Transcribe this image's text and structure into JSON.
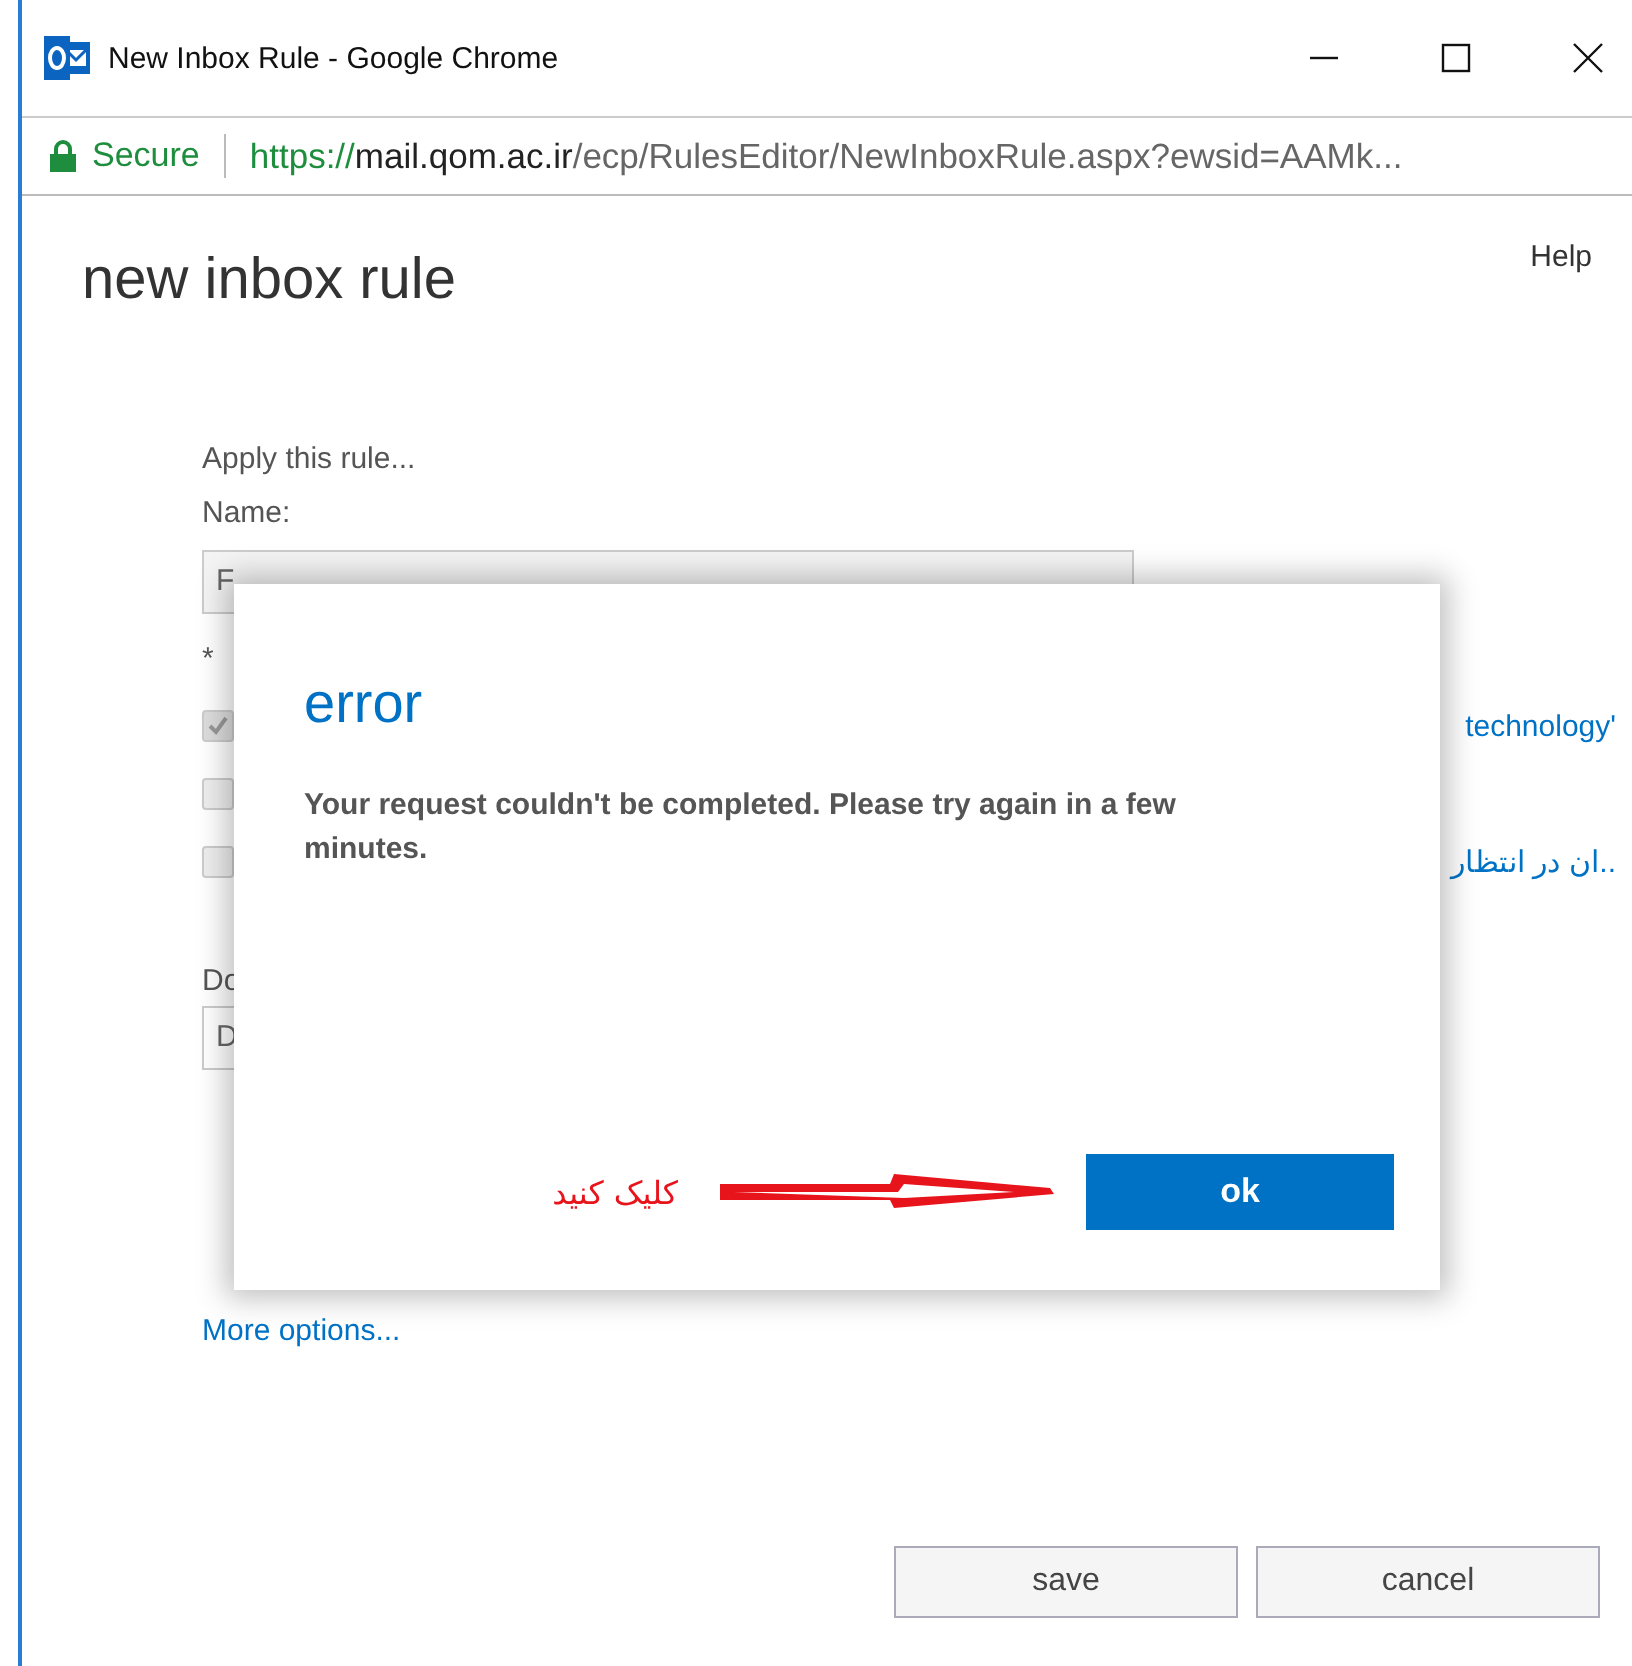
{
  "window": {
    "title": "New Inbox Rule - Google Chrome"
  },
  "address_bar": {
    "secure_label": "Secure",
    "url_scheme": "https://",
    "url_host": "mail.qom.ac.ir",
    "url_path": "/ecp/RulesEditor/NewInboxRule.aspx?ewsid=AAMk..."
  },
  "page": {
    "title": "new inbox rule",
    "help": "Help"
  },
  "form": {
    "intro": "Apply this rule...",
    "name_label": "Name:",
    "name_value": "F",
    "condition_label": "*",
    "conditions": [
      {
        "checked": true,
        "text": "technology'"
      },
      {
        "checked": false
      },
      {
        "checked": false,
        "text": "..ان در انتظار"
      }
    ],
    "action_label": "Do",
    "action_value": "D",
    "more_options": "More options..."
  },
  "buttons": [
    {
      "label": "save"
    },
    {
      "label": "cancel"
    }
  ],
  "dialog": {
    "title": "error",
    "message": "Your request couldn't be completed. Please try again in a few minutes.",
    "ok": "ok",
    "annotation": "کلیک کنید"
  }
}
